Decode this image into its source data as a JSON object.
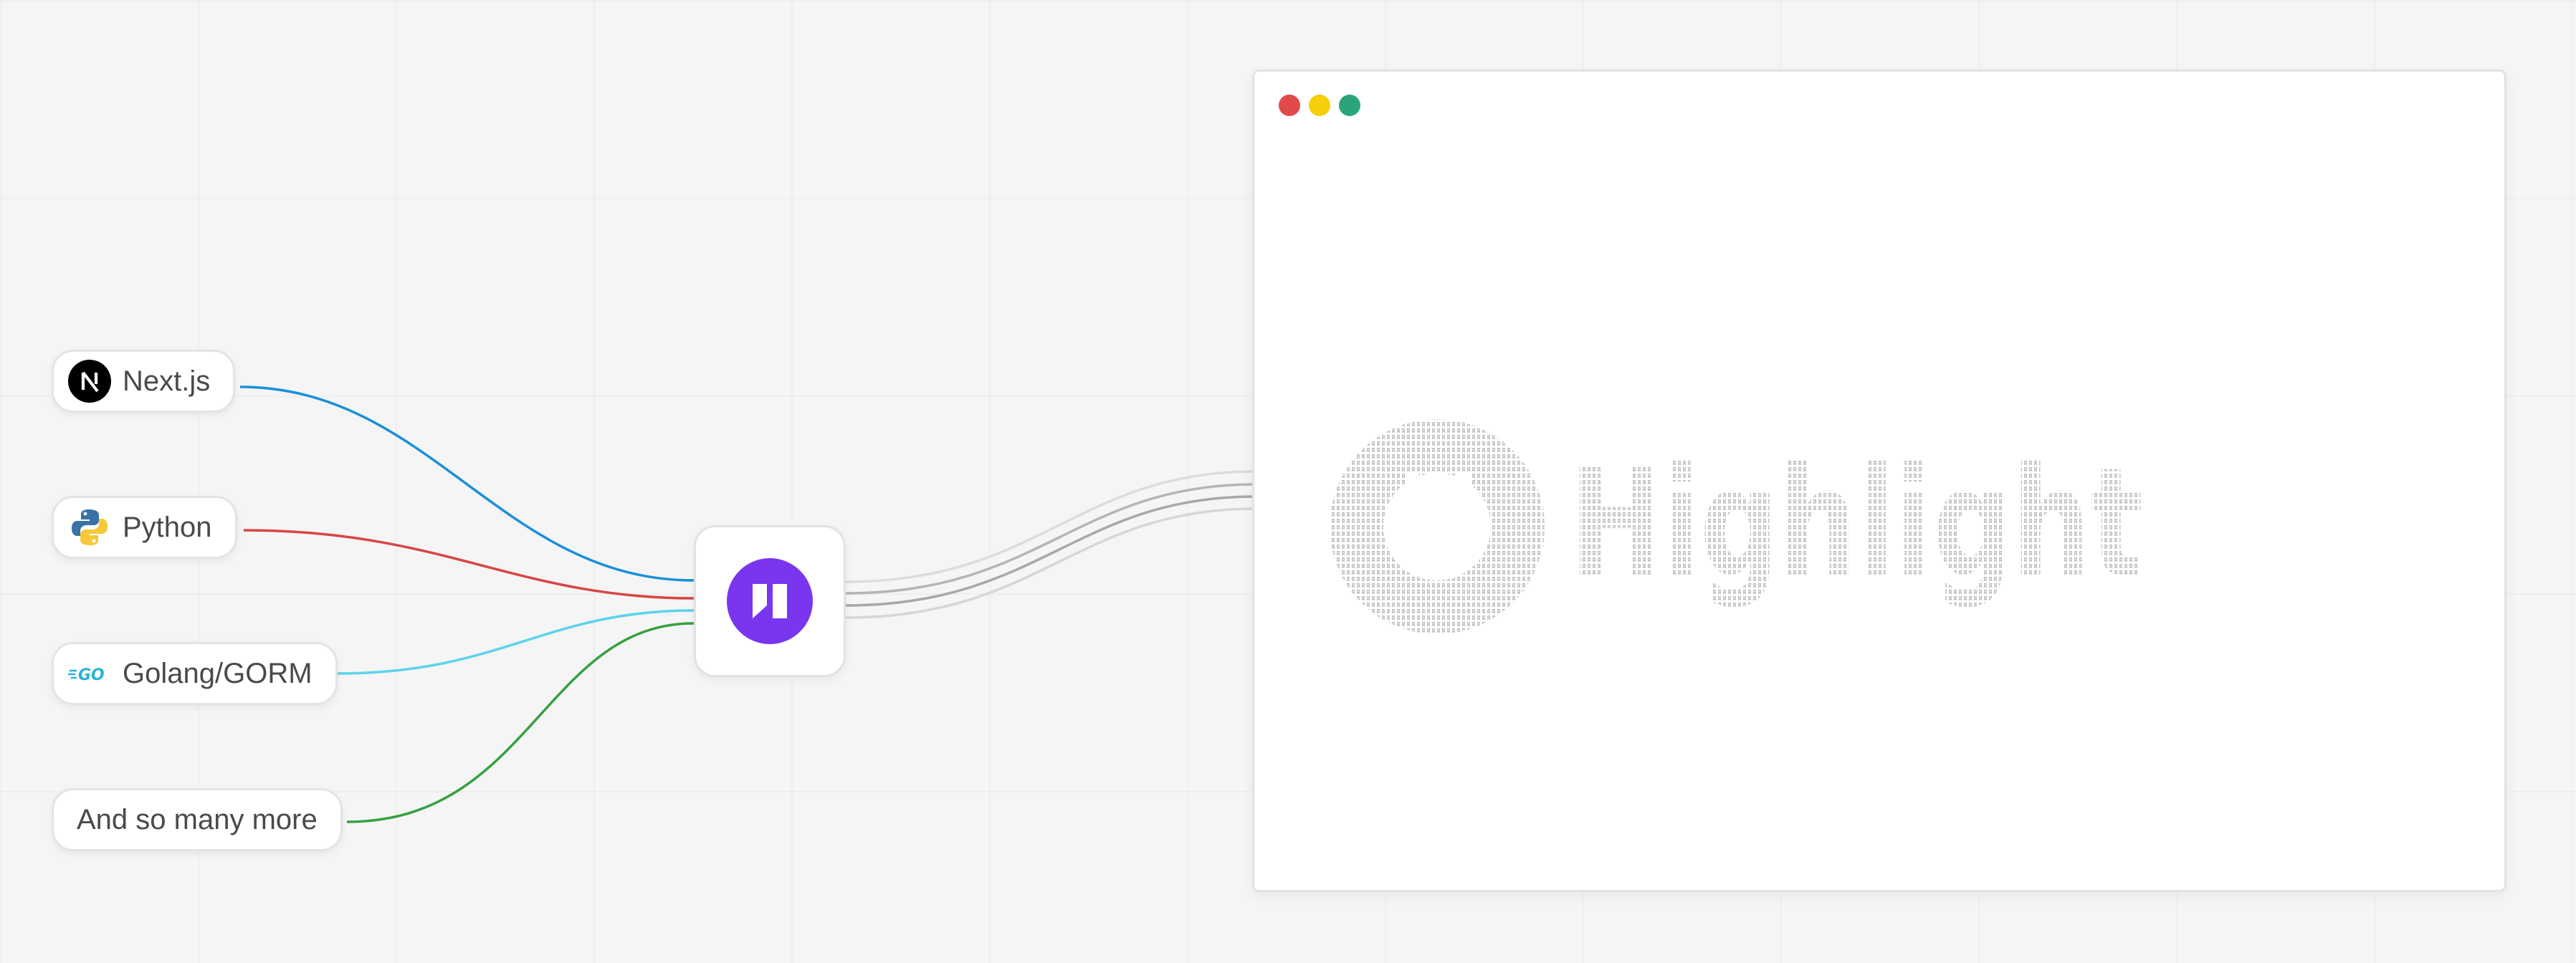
{
  "integrations": [
    {
      "label": "Next.js",
      "icon": "nextjs-icon",
      "wire_color": "#1a8fdb"
    },
    {
      "label": "Python",
      "icon": "python-icon",
      "wire_color": "#d84545"
    },
    {
      "label": "Golang/GORM",
      "icon": "go-icon",
      "wire_color": "#5dd3ea"
    },
    {
      "label": "And so many more",
      "icon": "",
      "wire_color": "#36a03f"
    }
  ],
  "hub": {
    "icon": "neon-logo-icon",
    "color": "#7a36ee"
  },
  "window": {
    "controls": [
      {
        "name": "close",
        "color": "#e24a4a"
      },
      {
        "name": "minimize",
        "color": "#f7cf0b"
      },
      {
        "name": "maximize",
        "color": "#2aa57a"
      }
    ],
    "content_icon": "highlight-ascii-logo",
    "ascii_color": "#b8b8b8"
  },
  "output_wire_color": "#bdbdbd"
}
